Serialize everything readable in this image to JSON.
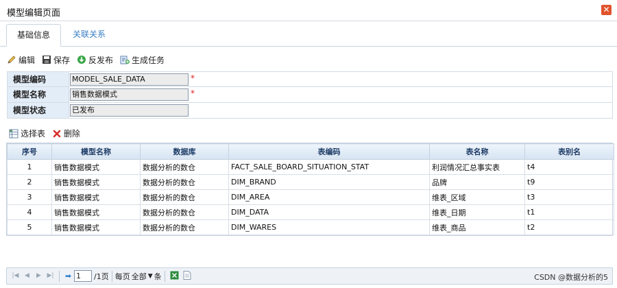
{
  "window": {
    "title": "模型编辑页面"
  },
  "tabs": [
    {
      "label": "基础信息"
    },
    {
      "label": "关联关系"
    }
  ],
  "toolbar": {
    "edit": "编辑",
    "save": "保存",
    "unpublish": "反发布",
    "generate_task": "生成任务"
  },
  "form": {
    "code_label": "模型编码",
    "code_value": "MODEL_SALE_DATA",
    "name_label": "模型名称",
    "name_value": "销售数据模式",
    "status_label": "模型状态",
    "status_value": "已发布",
    "required_mark": "*"
  },
  "subbar": {
    "select_table": "选择表",
    "delete": "删除"
  },
  "grid": {
    "columns": [
      "序号",
      "模型名称",
      "数据库",
      "表编码",
      "表名称",
      "表别名"
    ],
    "rows": [
      [
        "1",
        "销售数据模式",
        "数据分析的数仓",
        "FACT_SALE_BOARD_SITUATION_STAT",
        "利润情况汇总事实表",
        "t4"
      ],
      [
        "2",
        "销售数据模式",
        "数据分析的数仓",
        "DIM_BRAND",
        "品牌",
        "t9"
      ],
      [
        "3",
        "销售数据模式",
        "数据分析的数仓",
        "DIM_AREA",
        "维表_区域",
        "t3"
      ],
      [
        "4",
        "销售数据模式",
        "数据分析的数仓",
        "DIM_DATA",
        "维表_日期",
        "t1"
      ],
      [
        "5",
        "销售数据模式",
        "数据分析的数仓",
        "DIM_WARES",
        "维表_商品",
        "t2"
      ]
    ]
  },
  "pager": {
    "page_value": "1",
    "page_total": "/1页",
    "per_page_label": "每页",
    "per_page_value": "全部",
    "per_page_unit": "条",
    "info": "CSDN @数据分析的5"
  }
}
